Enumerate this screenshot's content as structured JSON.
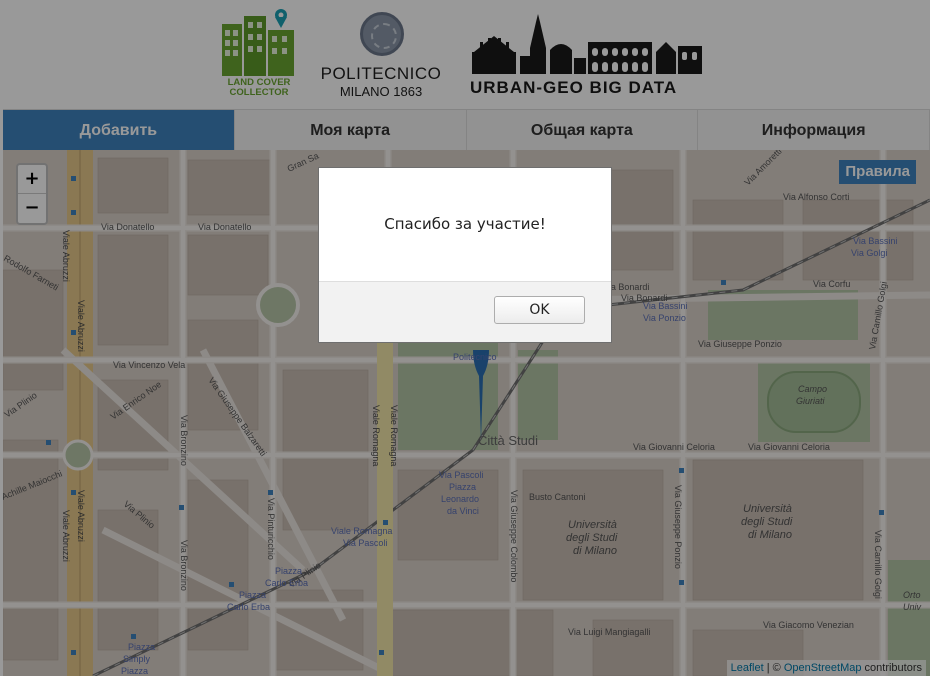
{
  "header": {
    "logo_lcc": "LAND COVER COLLECTOR",
    "logo_lcc_line1": "LAND COVER",
    "logo_lcc_line2": "COLLECTOR",
    "logo_polimi_name": "POLITECNICO",
    "logo_polimi_sub": "MILANO 1863",
    "logo_urban": "URBAN-GEO BIG DATA"
  },
  "tabs": [
    {
      "label": "Добавить",
      "active": true
    },
    {
      "label": "Моя карта",
      "active": false
    },
    {
      "label": "Общая карта",
      "active": false
    },
    {
      "label": "Информация",
      "active": false
    }
  ],
  "map": {
    "zoom_in": "+",
    "zoom_out": "−",
    "rules_label": "Правила",
    "attribution": {
      "leaflet": "Leaflet",
      "separator": " | © ",
      "osm": "OpenStreetMap",
      "suffix": " contributors"
    },
    "labels": {
      "via_donatello_1": "Via Donatello",
      "via_donatello_2": "Via Donatello",
      "viale_abruzzi": "Viale Abruzzi",
      "viale_abruzzi_2": "Viale Abruzzi",
      "rodolfo_farneti": "Rodolfo Farneti",
      "via_vincenzo_vela": "Via Vincenzo Vela",
      "via_plinio": "Via Plinio",
      "via_enrico_noe": "Via Enrico Noe",
      "via_giuseppe_balzaretti": "Via Giuseppe Balzaretti",
      "via_bronzino": "Via Bronzino",
      "viale_romagna": "Viale Romagna",
      "via_pinturicchio": "Via Pinturicchio",
      "citta_studi": "Città Studi",
      "via_pascoli": "Via Pascoli",
      "piazza_leonardo": "Piazza Leonardo da Vinci",
      "piazza_leonardo_1": "Piazza",
      "piazza_leonardo_2": "Leonardo",
      "piazza_leonardo_3": "da Vinci",
      "via_giovanni_celoria_1": "Via Giovanni Celoria",
      "via_giovanni_celoria_2": "Via Giovanni Celoria",
      "busto_cantoni": "Busto Cantoni",
      "universita_milano": "Università degli Studi di Milano",
      "universita_1": "Università",
      "universita_2": "degli Studi",
      "universita_3": "di Milano",
      "universita_b_1": "Università",
      "universita_b_2": "degli Studi",
      "universita_b_3": "di Milano",
      "via_giuseppe_colombo": "Via Giuseppe Colombo",
      "via_giuseppe_ponzio_1": "Via Giuseppe Ponzio",
      "via_giuseppe_ponzio_2": "Via Giuseppe Ponzio",
      "via_bassini_1": "Via Bassini",
      "via_bassini_2": "Via Bassini",
      "via_golgi": "Via Golgi",
      "via_ponzio": "Via Ponzio",
      "via_corfu": "Via Corfu",
      "via_bonardi_1": "Via Bonardi",
      "via_bonardi_2": "Via Bonardi",
      "via_alfonso_corti": "Via Alfonso Corti",
      "via_amoretti": "Via Amoretti",
      "campo_giuriati_1": "Campo",
      "campo_giuriati_2": "Giuriati",
      "via_camillo_golgi": "Via Camillo Golgi",
      "piazza_carlo_erba_1": "Piazza",
      "piazza_carlo_erba_2": "Carlo Erba",
      "piazza_carlo_erba_3": "Piazza",
      "piazza_carlo_erba_4": "Carlo Erba",
      "viale_romagna_via_pascoli_1": "Viale Romagna",
      "viale_romagna_via_pascoli_2": "Via Pascoli",
      "via_luigi_mangiagalli": "Via Luigi Mangiagalli",
      "via_giacomo_venezian": "Via Giacomo Venezian",
      "piazza_simply_1": "Piazza",
      "piazza_simply_2": "Simply",
      "piazza_simply_3": "Piazza",
      "via_achille_maiocchi": "Achille Maiocchi",
      "gran_sasso": "Gran Sa",
      "politecnico": "Politecnico",
      "orto_1": "Orto",
      "orto_2": "Univ"
    }
  },
  "dialog": {
    "message": "Спасибо за участие!",
    "ok_label": "OK"
  },
  "colors": {
    "tab_active": "#3e83bf",
    "rules_button": "#3e83bf",
    "lcc_green": "#6aa531"
  }
}
